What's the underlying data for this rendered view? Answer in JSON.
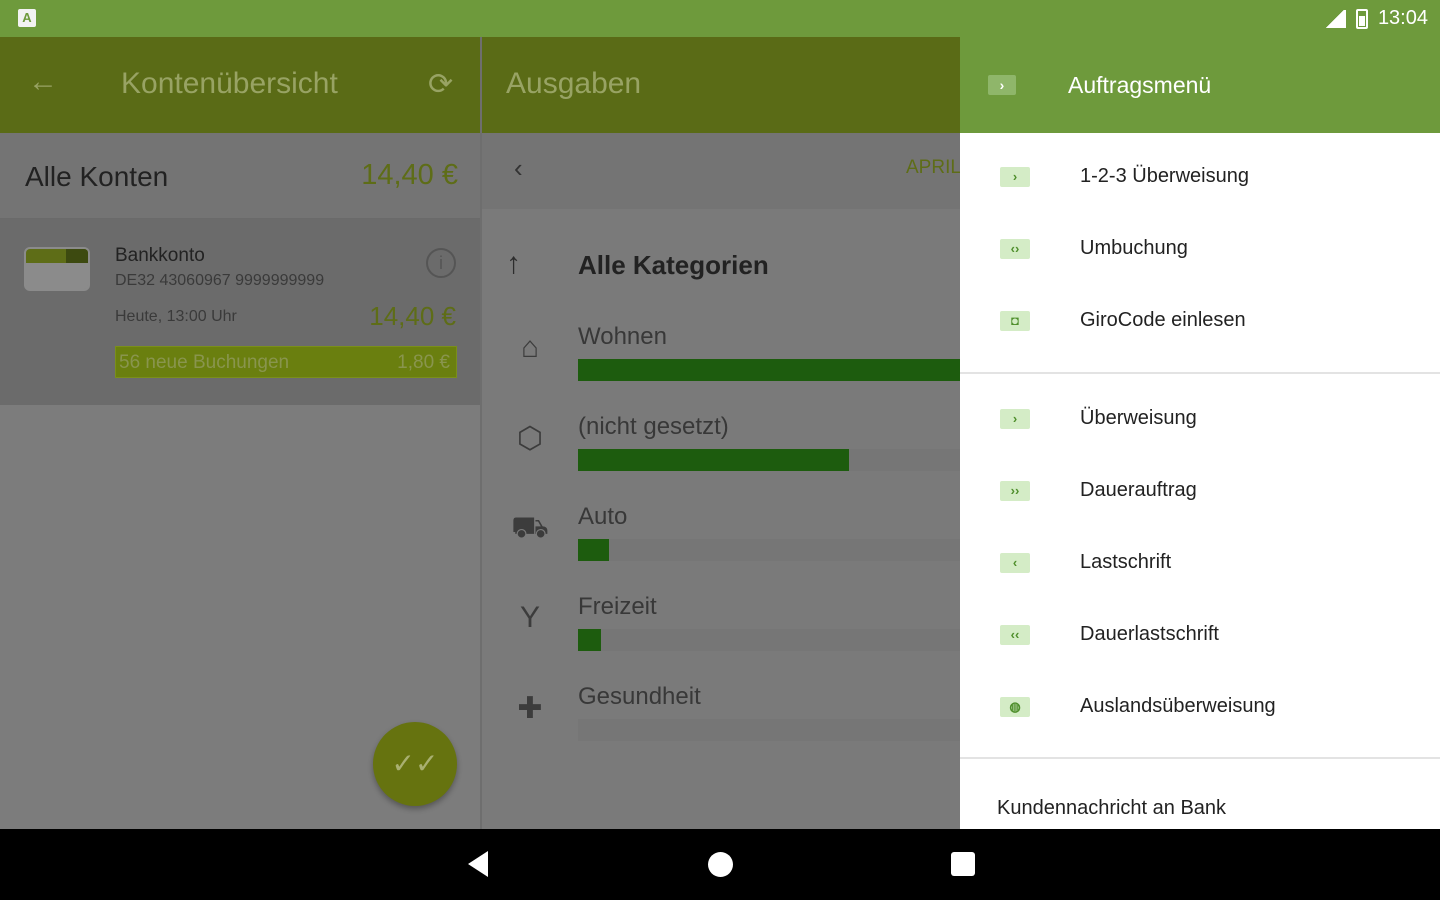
{
  "status_bar": {
    "time": "13:04",
    "app_indicator": "A"
  },
  "accounts_pane": {
    "title": "Kontenübersicht",
    "all_accounts_label": "Alle Konten",
    "all_accounts_amount": "14,40 €",
    "account": {
      "name": "Bankkonto",
      "iban": "DE32 43060967 9999999999",
      "updated": "Heute, 13:00 Uhr",
      "amount": "14,40 €",
      "new_bookings_label": "56 neue Buchungen",
      "new_bookings_amount": "1,80 €"
    }
  },
  "expenses_pane": {
    "title": "Ausgaben",
    "month": "APRIL",
    "all_categories_label": "Alle Kategorien",
    "categories": [
      {
        "label": "Wohnen",
        "icon": "house-icon",
        "share": 1.0
      },
      {
        "label": "(nicht gesetzt)",
        "icon": "tag-icon",
        "share": 0.71
      },
      {
        "label": "Auto",
        "icon": "car-icon",
        "share": 0.08
      },
      {
        "label": "Freizeit",
        "icon": "cocktail-icon",
        "share": 0.06
      },
      {
        "label": "Gesundheit",
        "icon": "medical-kit-icon",
        "share": 0.0
      }
    ]
  },
  "drawer": {
    "title": "Auftragsmenü",
    "group1": [
      {
        "label": "1-2-3 Überweisung",
        "glyph": "›"
      },
      {
        "label": "Umbuchung",
        "glyph": "‹›"
      },
      {
        "label": "GiroCode einlesen",
        "glyph": "◘"
      }
    ],
    "group2": [
      {
        "label": "Überweisung",
        "glyph": "›"
      },
      {
        "label": "Dauerauftrag",
        "glyph": "››"
      },
      {
        "label": "Lastschrift",
        "glyph": "‹"
      },
      {
        "label": "Dauerlastschrift",
        "glyph": "‹‹"
      },
      {
        "label": "Auslandsüberweisung",
        "glyph": "◍"
      }
    ],
    "footer_item": "Kundennachricht an Bank"
  },
  "colors": {
    "accent": "#6e9a3c",
    "bar_fill": "#1d5c0e"
  }
}
